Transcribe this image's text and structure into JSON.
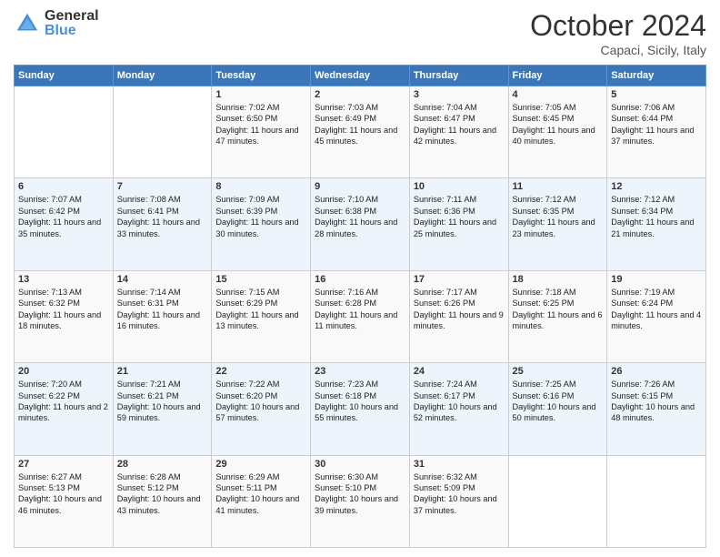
{
  "logo": {
    "general": "General",
    "blue": "Blue"
  },
  "header": {
    "month": "October 2024",
    "location": "Capaci, Sicily, Italy"
  },
  "weekdays": [
    "Sunday",
    "Monday",
    "Tuesday",
    "Wednesday",
    "Thursday",
    "Friday",
    "Saturday"
  ],
  "weeks": [
    [
      {
        "day": "",
        "content": ""
      },
      {
        "day": "",
        "content": ""
      },
      {
        "day": "1",
        "content": "Sunrise: 7:02 AM\nSunset: 6:50 PM\nDaylight: 11 hours and 47 minutes."
      },
      {
        "day": "2",
        "content": "Sunrise: 7:03 AM\nSunset: 6:49 PM\nDaylight: 11 hours and 45 minutes."
      },
      {
        "day": "3",
        "content": "Sunrise: 7:04 AM\nSunset: 6:47 PM\nDaylight: 11 hours and 42 minutes."
      },
      {
        "day": "4",
        "content": "Sunrise: 7:05 AM\nSunset: 6:45 PM\nDaylight: 11 hours and 40 minutes."
      },
      {
        "day": "5",
        "content": "Sunrise: 7:06 AM\nSunset: 6:44 PM\nDaylight: 11 hours and 37 minutes."
      }
    ],
    [
      {
        "day": "6",
        "content": "Sunrise: 7:07 AM\nSunset: 6:42 PM\nDaylight: 11 hours and 35 minutes."
      },
      {
        "day": "7",
        "content": "Sunrise: 7:08 AM\nSunset: 6:41 PM\nDaylight: 11 hours and 33 minutes."
      },
      {
        "day": "8",
        "content": "Sunrise: 7:09 AM\nSunset: 6:39 PM\nDaylight: 11 hours and 30 minutes."
      },
      {
        "day": "9",
        "content": "Sunrise: 7:10 AM\nSunset: 6:38 PM\nDaylight: 11 hours and 28 minutes."
      },
      {
        "day": "10",
        "content": "Sunrise: 7:11 AM\nSunset: 6:36 PM\nDaylight: 11 hours and 25 minutes."
      },
      {
        "day": "11",
        "content": "Sunrise: 7:12 AM\nSunset: 6:35 PM\nDaylight: 11 hours and 23 minutes."
      },
      {
        "day": "12",
        "content": "Sunrise: 7:12 AM\nSunset: 6:34 PM\nDaylight: 11 hours and 21 minutes."
      }
    ],
    [
      {
        "day": "13",
        "content": "Sunrise: 7:13 AM\nSunset: 6:32 PM\nDaylight: 11 hours and 18 minutes."
      },
      {
        "day": "14",
        "content": "Sunrise: 7:14 AM\nSunset: 6:31 PM\nDaylight: 11 hours and 16 minutes."
      },
      {
        "day": "15",
        "content": "Sunrise: 7:15 AM\nSunset: 6:29 PM\nDaylight: 11 hours and 13 minutes."
      },
      {
        "day": "16",
        "content": "Sunrise: 7:16 AM\nSunset: 6:28 PM\nDaylight: 11 hours and 11 minutes."
      },
      {
        "day": "17",
        "content": "Sunrise: 7:17 AM\nSunset: 6:26 PM\nDaylight: 11 hours and 9 minutes."
      },
      {
        "day": "18",
        "content": "Sunrise: 7:18 AM\nSunset: 6:25 PM\nDaylight: 11 hours and 6 minutes."
      },
      {
        "day": "19",
        "content": "Sunrise: 7:19 AM\nSunset: 6:24 PM\nDaylight: 11 hours and 4 minutes."
      }
    ],
    [
      {
        "day": "20",
        "content": "Sunrise: 7:20 AM\nSunset: 6:22 PM\nDaylight: 11 hours and 2 minutes."
      },
      {
        "day": "21",
        "content": "Sunrise: 7:21 AM\nSunset: 6:21 PM\nDaylight: 10 hours and 59 minutes."
      },
      {
        "day": "22",
        "content": "Sunrise: 7:22 AM\nSunset: 6:20 PM\nDaylight: 10 hours and 57 minutes."
      },
      {
        "day": "23",
        "content": "Sunrise: 7:23 AM\nSunset: 6:18 PM\nDaylight: 10 hours and 55 minutes."
      },
      {
        "day": "24",
        "content": "Sunrise: 7:24 AM\nSunset: 6:17 PM\nDaylight: 10 hours and 52 minutes."
      },
      {
        "day": "25",
        "content": "Sunrise: 7:25 AM\nSunset: 6:16 PM\nDaylight: 10 hours and 50 minutes."
      },
      {
        "day": "26",
        "content": "Sunrise: 7:26 AM\nSunset: 6:15 PM\nDaylight: 10 hours and 48 minutes."
      }
    ],
    [
      {
        "day": "27",
        "content": "Sunrise: 6:27 AM\nSunset: 5:13 PM\nDaylight: 10 hours and 46 minutes."
      },
      {
        "day": "28",
        "content": "Sunrise: 6:28 AM\nSunset: 5:12 PM\nDaylight: 10 hours and 43 minutes."
      },
      {
        "day": "29",
        "content": "Sunrise: 6:29 AM\nSunset: 5:11 PM\nDaylight: 10 hours and 41 minutes."
      },
      {
        "day": "30",
        "content": "Sunrise: 6:30 AM\nSunset: 5:10 PM\nDaylight: 10 hours and 39 minutes."
      },
      {
        "day": "31",
        "content": "Sunrise: 6:32 AM\nSunset: 5:09 PM\nDaylight: 10 hours and 37 minutes."
      },
      {
        "day": "",
        "content": ""
      },
      {
        "day": "",
        "content": ""
      }
    ]
  ]
}
